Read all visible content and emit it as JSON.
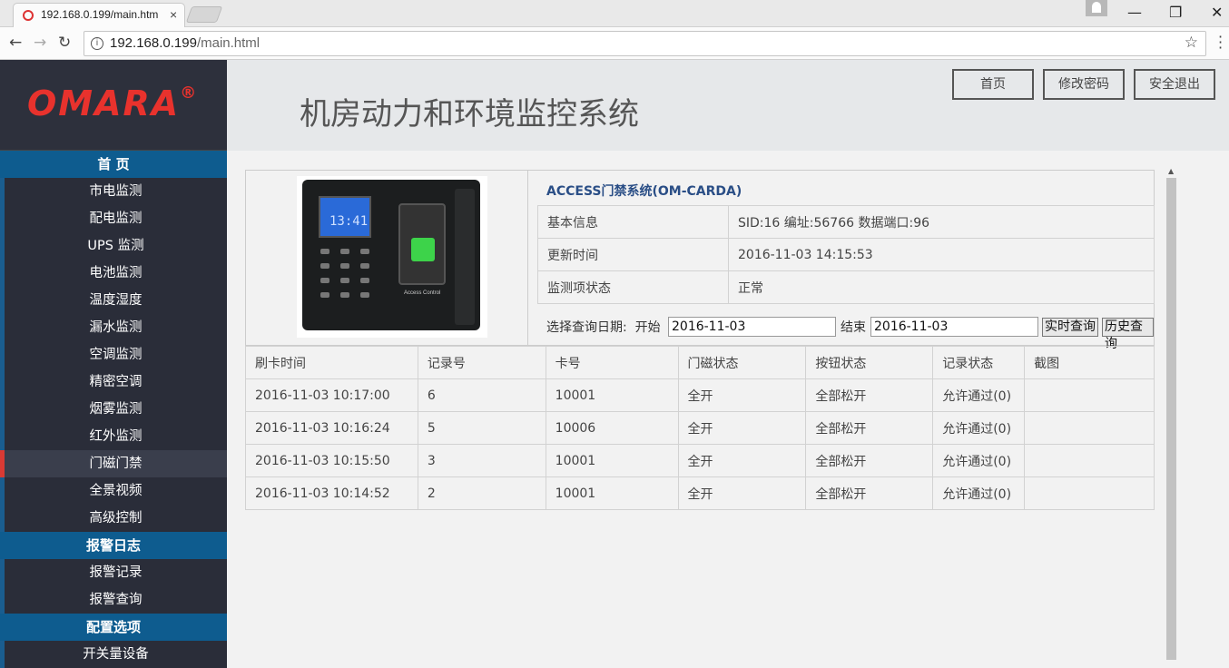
{
  "browser": {
    "tab_title": "192.168.0.199/main.htm",
    "tab_close": "×",
    "url_host": "192.168.0.199",
    "url_path": "/main.html",
    "back": "←",
    "forward": "→",
    "reload": "↻",
    "star": "☆",
    "minimize": "—",
    "maximize": "❐",
    "close": "✕"
  },
  "logo": {
    "text": "OMARA",
    "reg": "®"
  },
  "nav": [
    {
      "type": "head",
      "label": "首 页"
    },
    {
      "type": "item",
      "label": "市电监测"
    },
    {
      "type": "item",
      "label": "配电监测"
    },
    {
      "type": "item",
      "label": "UPS 监测"
    },
    {
      "type": "item",
      "label": "电池监测"
    },
    {
      "type": "item",
      "label": "温度湿度"
    },
    {
      "type": "item",
      "label": "漏水监测"
    },
    {
      "type": "item",
      "label": "空调监测"
    },
    {
      "type": "item",
      "label": "精密空调"
    },
    {
      "type": "item",
      "label": "烟雾监测"
    },
    {
      "type": "item",
      "label": "红外监测"
    },
    {
      "type": "item",
      "label": "门磁门禁",
      "active": true
    },
    {
      "type": "item",
      "label": "全景视频"
    },
    {
      "type": "item",
      "label": "高级控制"
    },
    {
      "type": "head",
      "label": "报警日志"
    },
    {
      "type": "item",
      "label": "报警记录"
    },
    {
      "type": "item",
      "label": "报警查询"
    },
    {
      "type": "head",
      "label": "配置选项"
    },
    {
      "type": "item",
      "label": "开关量设备"
    }
  ],
  "header": {
    "title": "机房动力和环境监控系统",
    "home_btn": "首页",
    "password_btn": "修改密码",
    "logout_btn": "安全退出"
  },
  "device": {
    "clock": "13:41",
    "label": "Access Control",
    "title": "ACCESS门禁系统(OM-CARDA)",
    "rows": [
      {
        "key": "基本信息",
        "value": "SID:16   编址:56766   数据端口:96"
      },
      {
        "key": "更新时间",
        "value": "2016-11-03 14:15:53"
      },
      {
        "key": "监测项状态",
        "value": "正常"
      }
    ]
  },
  "query": {
    "label": "选择查询日期:",
    "start_label": "开始",
    "start_value": "2016-11-03",
    "end_label": "结束",
    "end_value": "2016-11-03",
    "realtime_btn": "实时查询",
    "history_btn": "历史查询"
  },
  "records": {
    "headers": [
      "刷卡时间",
      "记录号",
      "卡号",
      "门磁状态",
      "按钮状态",
      "记录状态",
      "截图"
    ],
    "rows": [
      [
        "2016-11-03 10:17:00",
        "6",
        "10001",
        "全开",
        "全部松开",
        "允许通过(0)",
        ""
      ],
      [
        "2016-11-03 10:16:24",
        "5",
        "10006",
        "全开",
        "全部松开",
        "允许通过(0)",
        ""
      ],
      [
        "2016-11-03 10:15:50",
        "3",
        "10001",
        "全开",
        "全部松开",
        "允许通过(0)",
        ""
      ],
      [
        "2016-11-03 10:14:52",
        "2",
        "10001",
        "全开",
        "全部松开",
        "允许通过(0)",
        ""
      ]
    ]
  }
}
